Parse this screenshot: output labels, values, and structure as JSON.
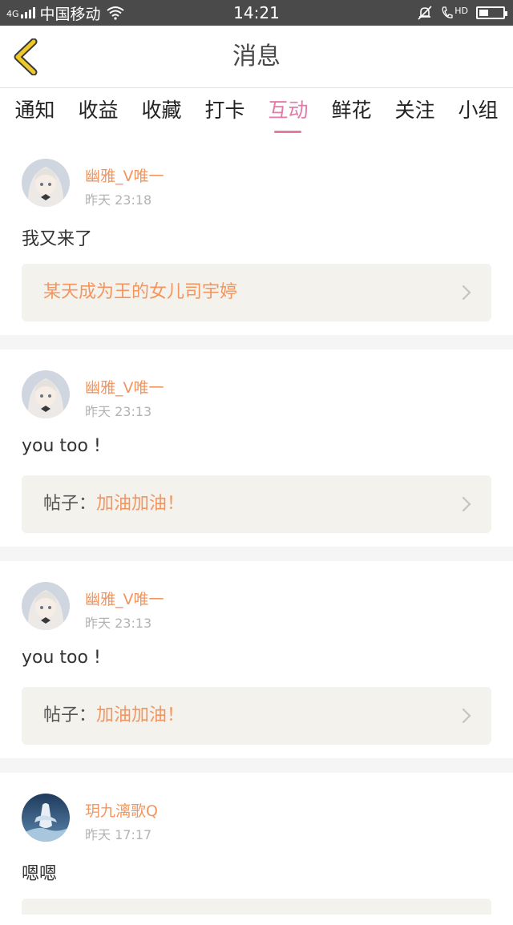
{
  "status_bar": {
    "network": "4G",
    "carrier": "中国移动",
    "time": "14:21",
    "call_badge": "HD",
    "battery_level_percent": 40
  },
  "navbar": {
    "title": "消息",
    "back_icon": "chevron-left-icon",
    "accent_color": "#f0c929"
  },
  "tabs": [
    {
      "label": "通知",
      "active": false
    },
    {
      "label": "收益",
      "active": false
    },
    {
      "label": "收藏",
      "active": false
    },
    {
      "label": "打卡",
      "active": false
    },
    {
      "label": "互动",
      "active": true
    },
    {
      "label": "鲜花",
      "active": false
    },
    {
      "label": "关注",
      "active": false
    },
    {
      "label": "小组",
      "active": false
    }
  ],
  "messages": [
    {
      "user": "幽雅_V唯一",
      "time": "昨天 23:18",
      "text": "我又来了",
      "ref_label": "",
      "ref_value": "某天成为王的女儿司宇婷"
    },
    {
      "user": "幽雅_V唯一",
      "time": "昨天 23:13",
      "text": "you too !",
      "ref_label": "帖子：",
      "ref_value": "加油加油！"
    },
    {
      "user": "幽雅_V唯一",
      "time": "昨天 23:13",
      "text": "you too !",
      "ref_label": "帖子：",
      "ref_value": "加油加油！"
    },
    {
      "user": "玥九漓歌Q",
      "time": "昨天 17:17",
      "text": "嗯嗯"
    }
  ],
  "colors": {
    "active_tab": "#e47aa6",
    "username": "#f3955f",
    "ref_background": "#f3f2ec"
  }
}
